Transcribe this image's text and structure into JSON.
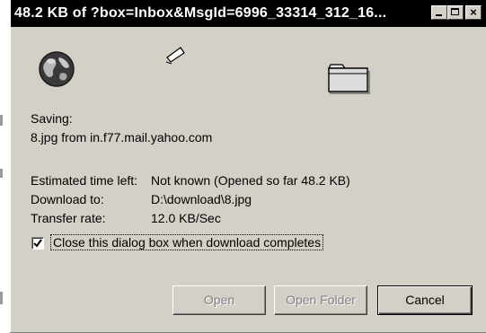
{
  "window": {
    "title": "48.2 KB of ?box=Inbox&MsgId=6996_33314_312_16...",
    "colors": {
      "titlebar": "#000000",
      "face": "#d4d0c8"
    }
  },
  "icons": {
    "globe": "globe-icon",
    "document": "flying-document-icon",
    "folder": "folder-icon"
  },
  "status": {
    "saving_label": "Saving:",
    "file_source": "8.jpg from in.f77.mail.yahoo.com"
  },
  "details": {
    "est_label": "Estimated time left:",
    "est_value": "Not known (Opened so far 48.2 KB)",
    "dl_label": "Download to:",
    "dl_value": "D:\\download\\8.jpg",
    "rate_label": "Transfer rate:",
    "rate_value": "12.0 KB/Sec"
  },
  "close_option": {
    "checked": true,
    "label": "Close this dialog box when download completes"
  },
  "buttons": {
    "open": "Open",
    "open_folder": "Open Folder",
    "cancel": "Cancel"
  }
}
